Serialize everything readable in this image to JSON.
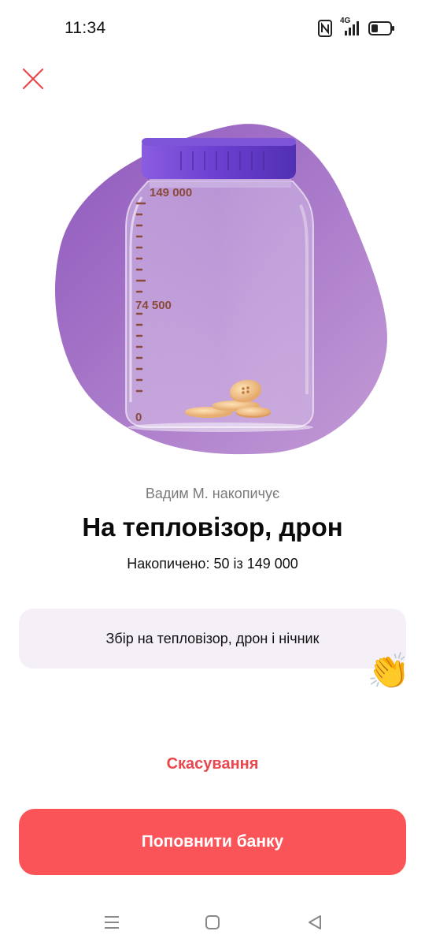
{
  "status_bar": {
    "time": "11:34",
    "network_label": "4G",
    "icons": [
      "nfc-icon",
      "signal-icon",
      "battery-icon"
    ]
  },
  "close_icon": "close-icon",
  "jar": {
    "scale_top": "149 000",
    "scale_mid": "74 500",
    "scale_bottom": "0",
    "fill_fraction": 0.0003
  },
  "owner_line": "Вадим М. накопичує",
  "title": "На тепловізор, дрон",
  "progress_text": "Накопичено: 50 із 149 000",
  "description": "Збір на тепловізор, дрон і нічник",
  "clap_icon": "clapping-hands-icon",
  "cancel_label": "Скасування",
  "topup_label": "Поповнити банку",
  "colors": {
    "accent": "#fb5458",
    "cancel": "#e9474e",
    "blob": "#9a62c2",
    "lid": "#6a3fc4",
    "card": "#f5f0f8"
  },
  "nav": [
    "menu-icon",
    "home-icon",
    "back-icon"
  ]
}
